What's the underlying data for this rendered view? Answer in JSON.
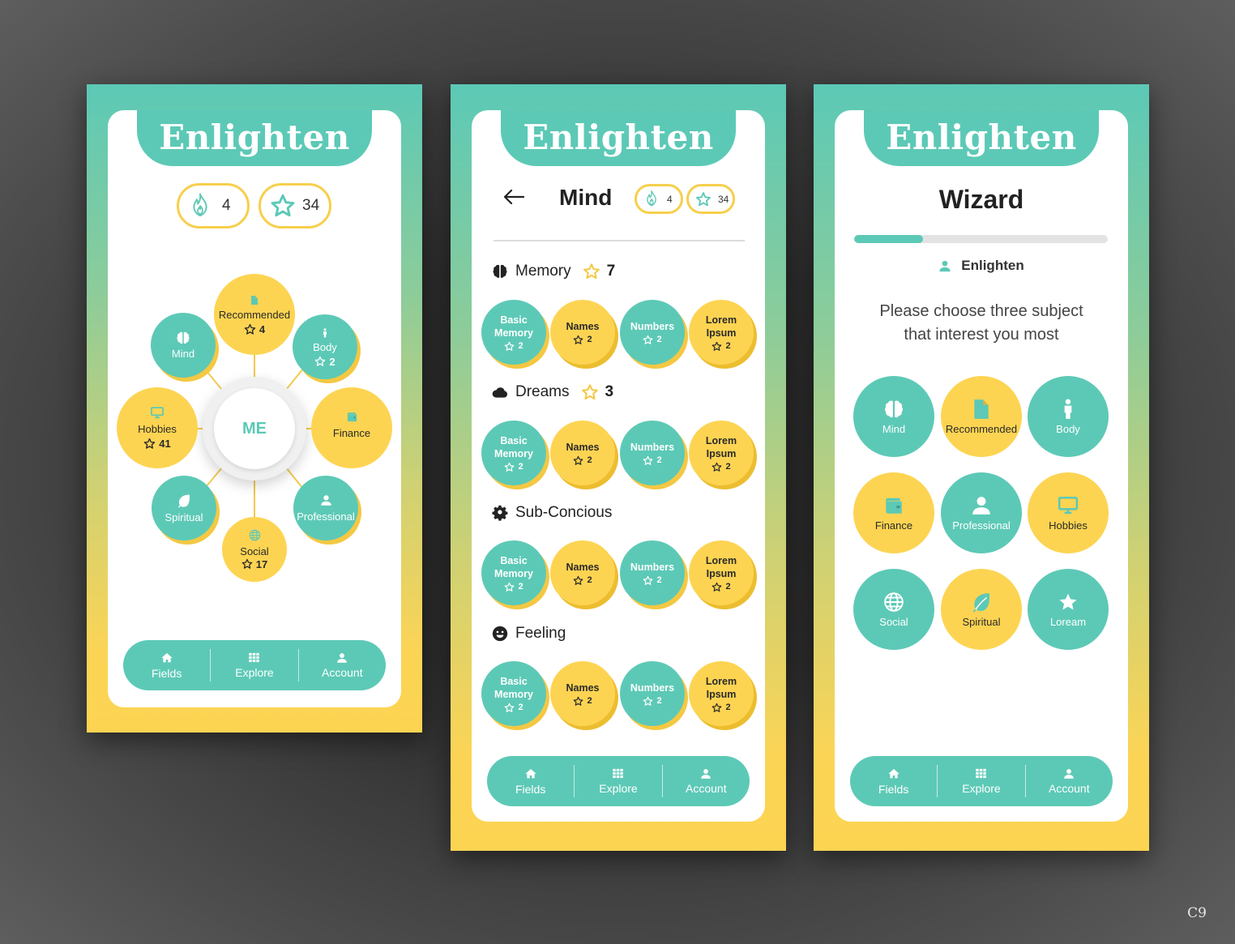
{
  "brand": "Enlighten",
  "colors": {
    "teal": "#5cc9b6",
    "yellow": "#fdd452",
    "pill_border": "#f7cf4c"
  },
  "screen1": {
    "streak": "4",
    "stars": "34",
    "center": "ME",
    "nodes": {
      "recommended": {
        "label": "Recommended",
        "count": "4"
      },
      "mind": {
        "label": "Mind"
      },
      "body": {
        "label": "Body",
        "count": "2"
      },
      "hobbies": {
        "label": "Hobbies",
        "count": "41"
      },
      "finance": {
        "label": "Finance"
      },
      "spiritual": {
        "label": "Spiritual"
      },
      "professional": {
        "label": "Professional"
      },
      "social": {
        "label": "Social",
        "count": "17"
      }
    }
  },
  "screen2": {
    "title": "Mind",
    "streak": "4",
    "stars": "34",
    "sections": [
      {
        "title": "Memory",
        "count": "7",
        "icon": "brain-icon"
      },
      {
        "title": "Dreams",
        "count": "3",
        "icon": "cloud-icon"
      },
      {
        "title": "Sub-Concious",
        "icon": "gear-icon"
      },
      {
        "title": "Feeling",
        "icon": "smiley-icon"
      }
    ],
    "items": [
      {
        "l1": "Basic",
        "l2": "Memory",
        "count": "2"
      },
      {
        "l1": "Names",
        "l2": "",
        "count": "2"
      },
      {
        "l1": "Numbers",
        "l2": "",
        "count": "2"
      },
      {
        "l1": "Lorem",
        "l2": "Ipsum",
        "count": "2"
      }
    ]
  },
  "screen3": {
    "title": "Wizard",
    "progress": 0.27,
    "user": "Enlighten",
    "prompt_line1": "Please choose three subject",
    "prompt_line2": "that interest you most",
    "subjects": [
      {
        "label": "Mind",
        "icon": "brain-icon"
      },
      {
        "label": "Recommended",
        "icon": "document-icon"
      },
      {
        "label": "Body",
        "icon": "person-icon"
      },
      {
        "label": "Finance",
        "icon": "wallet-icon"
      },
      {
        "label": "Professional",
        "icon": "user-icon"
      },
      {
        "label": "Hobbies",
        "icon": "monitor-icon"
      },
      {
        "label": "Social",
        "icon": "globe-icon"
      },
      {
        "label": "Spiritual",
        "icon": "leaf-icon"
      },
      {
        "label": "Loream",
        "icon": "star-icon"
      }
    ]
  },
  "nav": {
    "fields": "Fields",
    "explore": "Explore",
    "account": "Account"
  },
  "corner_label": "C9"
}
